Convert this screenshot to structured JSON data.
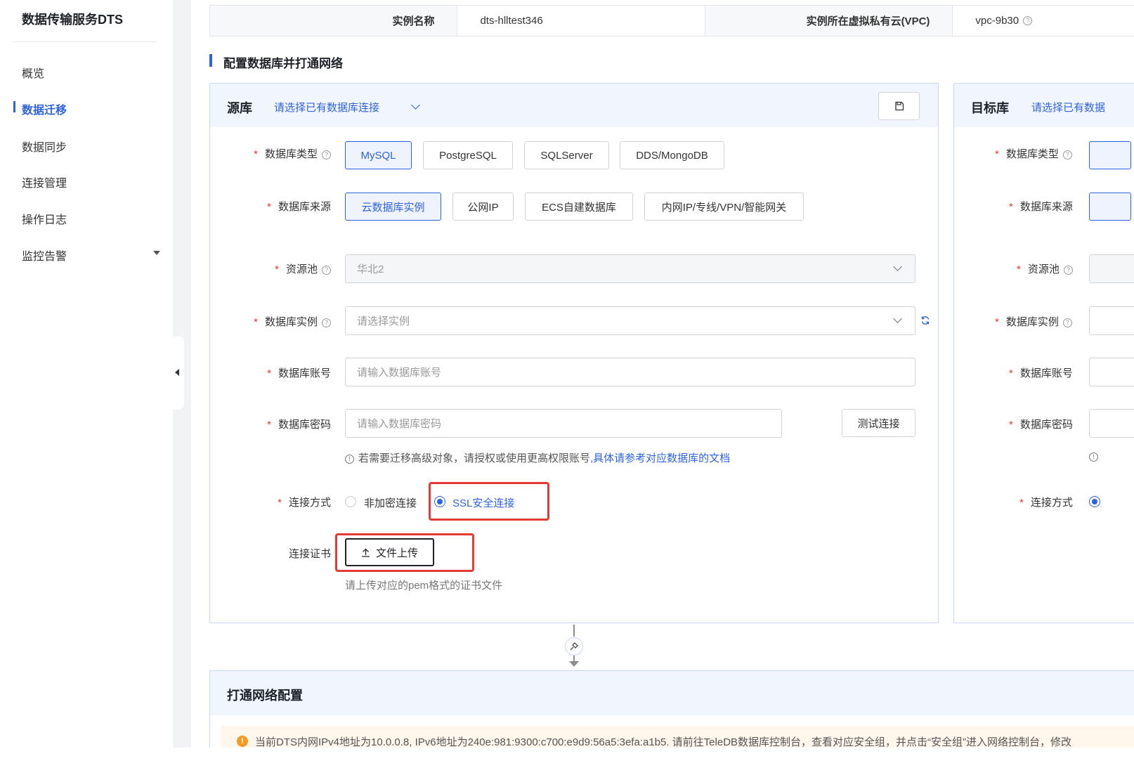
{
  "sidebar": {
    "brand": "数据传输服务DTS",
    "items": [
      {
        "label": "概览"
      },
      {
        "label": "数据迁移"
      },
      {
        "label": "数据同步"
      },
      {
        "label": "连接管理"
      },
      {
        "label": "操作日志"
      },
      {
        "label": "监控告警"
      }
    ]
  },
  "info": {
    "instance_name_label": "实例名称",
    "instance_name_value": "dts-hlltest346",
    "vpc_label": "实例所在虚拟私有云(VPC)",
    "vpc_value": "vpc-9b30"
  },
  "section_title": "配置数据库并打通网络",
  "source": {
    "title": "源库",
    "select_placeholder": "请选择已有数据库连接",
    "db_type_label": "数据库类型",
    "db_types": [
      "MySQL",
      "PostgreSQL",
      "SQLServer",
      "DDS/MongoDB"
    ],
    "db_source_label": "数据库来源",
    "db_sources": [
      "云数据库实例",
      "公网IP",
      "ECS自建数据库",
      "内网IP/专线/VPN/智能网关"
    ],
    "pool_label": "资源池",
    "pool_value": "华北2",
    "instance_label": "数据库实例",
    "instance_placeholder": "请选择实例",
    "account_label": "数据库账号",
    "account_placeholder": "请输入数据库账号",
    "password_label": "数据库密码",
    "password_placeholder": "请输入数据库密码",
    "test_button": "测试连接",
    "tip_text": "若需要迁移高级对象，请授权或使用更高权限账号",
    "tip_link": ",具体请参考对应数据库的文档",
    "conn_label": "连接方式",
    "conn_options": [
      "非加密连接",
      "SSL安全连接"
    ],
    "cert_label": "连接证书",
    "upload_button": "文件上传",
    "cert_hint": "请上传对应的pem格式的证书文件"
  },
  "target": {
    "title": "目标库",
    "select_placeholder": "请选择已有数据",
    "db_type_label": "数据库类型",
    "db_source_label": "数据库来源",
    "pool_label": "资源池",
    "instance_label": "数据库实例",
    "account_label": "数据库账号",
    "password_label": "数据库密码",
    "conn_label": "连接方式"
  },
  "network": {
    "title": "打通网络配置",
    "warning": "当前DTS内网IPv4地址为10.0.0.8, IPv6地址为240e:981:9300:c700:e9d9:56a5:3efa:a1b5. 请前往TeleDB数据库控制台，查看对应安全组，并点击“安全组”进入网络控制台，修改"
  },
  "colors": {
    "accent": "#2e63e0",
    "highlight": "#e53935",
    "warning": "#f59a23"
  }
}
